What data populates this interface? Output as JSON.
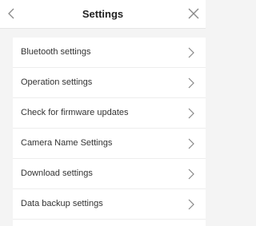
{
  "header": {
    "title": "Settings",
    "back_icon": "chevron-left-icon",
    "close_icon": "close-icon"
  },
  "menu": {
    "items": [
      {
        "label": "Bluetooth settings"
      },
      {
        "label": "Operation settings"
      },
      {
        "label": "Check for firmware updates"
      },
      {
        "label": "Camera Name Settings"
      },
      {
        "label": "Download settings"
      },
      {
        "label": "Data backup settings"
      }
    ]
  },
  "colors": {
    "background": "#f4f4f4",
    "surface": "#ffffff",
    "text": "#333333",
    "icon": "#888888"
  }
}
